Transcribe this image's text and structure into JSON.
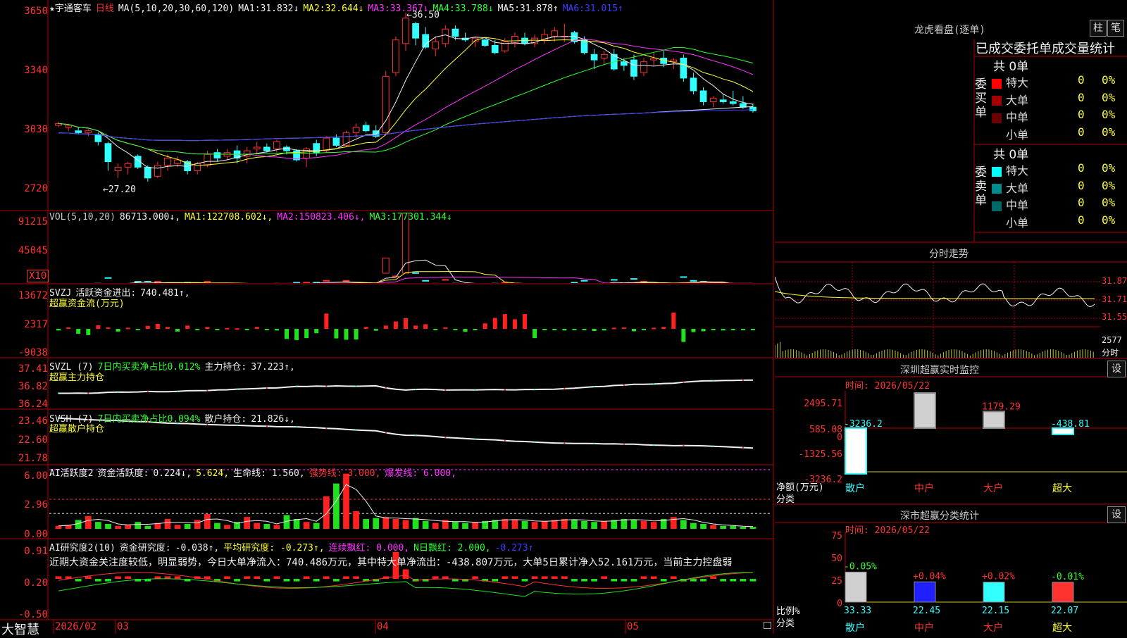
{
  "main": {
    "stock_name": "★宇通客车",
    "period": "日线",
    "ma_header": "MA(5,10,20,30,60,120)",
    "ma": [
      {
        "label": "MA1:",
        "value": "31.832↓",
        "color": "#f0f0f0"
      },
      {
        "label": "MA2:",
        "value": "32.644↓",
        "color": "#ffff32"
      },
      {
        "label": "MA3:",
        "value": "33.367↓",
        "color": "#ff32ff"
      },
      {
        "label": "MA4:",
        "value": "33.788↓",
        "color": "#32ff32"
      },
      {
        "label": "MA5:",
        "value": "31.878↑",
        "color": "#f0f0f0"
      },
      {
        "label": "MA6:",
        "value": "31.015↑",
        "color": "#3c3cff"
      }
    ],
    "y_ticks": [
      "3650",
      "3340",
      "3030",
      "2720"
    ],
    "high_label": "←36.50",
    "low_label": "←27.20"
  },
  "vol": {
    "header": "VOL(5,10,20)",
    "value": "86713.000↓,",
    "ma": [
      {
        "label": "MA1:",
        "value": "122708.602↓,",
        "color": "#ffff32"
      },
      {
        "label": "MA2:",
        "value": "150823.406↓,",
        "color": "#ff32ff"
      },
      {
        "label": "MA3:",
        "value": "177301.344↓",
        "color": "#32ff32"
      }
    ],
    "y_ticks": [
      "91215",
      "45045"
    ],
    "multiplier": "X10"
  },
  "svzj": {
    "header": "SVZJ",
    "label": "活跃资金进出:",
    "value": "740.481↑,",
    "sub": "超赢资金流(万元)",
    "y_ticks": [
      "13672",
      "2317",
      "-9038"
    ]
  },
  "svzl": {
    "header": "SVZL (7)",
    "label": "7日内买卖净占比0.012%",
    "label2": "主力持仓:",
    "value": "37.223↑,",
    "sub": "超赢主力持仓",
    "y_ticks": [
      "37.41",
      "36.82",
      "36.24"
    ]
  },
  "svsh": {
    "header": "SVSH (7)",
    "label": "7日内买卖净占比0.094%",
    "label2": "散户持仓:",
    "value": "21.826↓,",
    "sub": "超赢散户持仓",
    "y_ticks": [
      "23.46",
      "22.60",
      "21.78"
    ]
  },
  "ai1": {
    "header": "AI活跃度2",
    "label": "资金活跃度:",
    "value": "0.224↓,",
    "value2": "5.624,",
    "life": "生命线: 1.560,",
    "strong": "强势线: 3.000,",
    "burst": "爆发线: 6.000,",
    "y_ticks": [
      "6.00",
      "2.96",
      "0.00"
    ]
  },
  "ai2": {
    "header": "AI研究度2(10)",
    "label": "资金研究度:",
    "value": "-0.038↑,",
    "avg": "平均研究度: -0.273↑,",
    "cont": "连续飘红: 0.000,",
    "nday": "N日飘红: 2.000,",
    "last": "-0.273↑",
    "comment": "近期大资金关注度较低，明显弱势，今日大单净流入：740.486万元，其中特大单净流出：-438.807万元，大单5日累计净入52.161万元，当前主力控盘弱",
    "y_ticks": [
      "0.91",
      "0.20",
      "-0.50"
    ]
  },
  "footer": {
    "brand": "大智慧",
    "dates": [
      "2026/02",
      "03",
      "04",
      "05"
    ]
  },
  "longhu": {
    "title": "龙虎看盘(逐单)",
    "btn_zhu": "柱",
    "btn_bi": "笔",
    "subtitle": "已成交委托单成交量统计",
    "buy_label": "委买单",
    "sell_label": "委卖单",
    "buy_total": "共 0单",
    "sell_total": "共 0单",
    "buy_rows": [
      {
        "name": "特大",
        "v": "0",
        "p": "0%",
        "color": "#ff0000"
      },
      {
        "name": "大单",
        "v": "0",
        "p": "0%",
        "color": "#a00000"
      },
      {
        "name": "中单",
        "v": "0",
        "p": "0%",
        "color": "#6a0000"
      },
      {
        "name": "小单",
        "v": "0",
        "p": "0%",
        "color": "#000000"
      }
    ],
    "sell_rows": [
      {
        "name": "特大",
        "v": "0",
        "p": "0%",
        "color": "#00ffff"
      },
      {
        "name": "大单",
        "v": "0",
        "p": "0%",
        "color": "#008c8c"
      },
      {
        "name": "中单",
        "v": "0",
        "p": "0%",
        "color": "#006868"
      },
      {
        "name": "小单",
        "v": "0",
        "p": "0%",
        "color": "#000000"
      }
    ]
  },
  "fenshi": {
    "title": "分时走势",
    "y_ticks": [
      "31.87",
      "31.71",
      "31.55"
    ],
    "vol_tick": "2577",
    "vol_unit": "分时"
  },
  "monitor": {
    "title": "深圳超赢实时监控",
    "set": "设",
    "time": "时间: 2026/05/22",
    "y_ticks": [
      "2495.71",
      "585.08",
      "0",
      "-1325.56",
      "-3236.2"
    ],
    "unit": "净额(万元)",
    "cat_label": "分类",
    "categories": [
      "散户",
      "中户",
      "大户",
      "超大"
    ]
  },
  "classify": {
    "title": "深市超赢分类统计",
    "set": "设",
    "time": "时间: 2026/05/22",
    "y_ticks": [
      "75",
      "50",
      "25",
      "0"
    ],
    "unit": "比例%",
    "cat_label": "分类",
    "categories": [
      "散户",
      "中户",
      "大户",
      "超大"
    ]
  },
  "chart_data": [
    {
      "type": "candlestick",
      "title": "宇通客车 日线",
      "ylim": [
        27.2,
        36.5
      ],
      "ohlc": [
        [
          30.3,
          30.5,
          30.2,
          30.4
        ],
        [
          30.2,
          30.4,
          30.0,
          30.3
        ],
        [
          30.0,
          30.2,
          29.8,
          29.9
        ],
        [
          29.9,
          30.1,
          29.7,
          30.0
        ],
        [
          29.8,
          29.9,
          29.2,
          29.4
        ],
        [
          29.3,
          29.4,
          27.8,
          28.3
        ],
        [
          27.8,
          28.2,
          27.4,
          28.0
        ],
        [
          28.0,
          28.3,
          27.6,
          28.2
        ],
        [
          28.6,
          28.7,
          27.9,
          28.0
        ],
        [
          28.0,
          28.1,
          27.2,
          27.4
        ],
        [
          27.5,
          28.3,
          27.4,
          28.1
        ],
        [
          28.1,
          28.7,
          27.8,
          28.5
        ],
        [
          28.2,
          28.6,
          28.0,
          28.4
        ],
        [
          28.3,
          28.4,
          27.6,
          27.8
        ],
        [
          27.8,
          28.3,
          27.6,
          28.2
        ],
        [
          28.1,
          28.9,
          28.0,
          28.7
        ],
        [
          28.8,
          29.0,
          28.3,
          28.5
        ],
        [
          28.6,
          29.0,
          28.4,
          28.8
        ],
        [
          28.9,
          29.2,
          28.2,
          28.5
        ],
        [
          28.6,
          29.1,
          28.2,
          28.9
        ],
        [
          29.0,
          29.4,
          28.7,
          29.1
        ],
        [
          29.1,
          29.3,
          28.8,
          28.9
        ],
        [
          29.0,
          29.5,
          28.8,
          29.4
        ],
        [
          29.1,
          29.2,
          28.7,
          28.9
        ],
        [
          28.9,
          29.0,
          28.3,
          28.4
        ],
        [
          28.5,
          29.1,
          28.0,
          29.0
        ],
        [
          29.3,
          29.5,
          28.6,
          28.8
        ],
        [
          28.9,
          29.7,
          28.8,
          29.6
        ],
        [
          29.6,
          29.8,
          29.1,
          29.2
        ],
        [
          29.2,
          30.0,
          29.1,
          29.9
        ],
        [
          29.9,
          30.4,
          29.6,
          30.2
        ],
        [
          30.3,
          30.5,
          29.9,
          30.0
        ],
        [
          30.0,
          30.3,
          29.6,
          29.7
        ],
        [
          29.9,
          33.3,
          29.8,
          33.0
        ],
        [
          33.2,
          35.2,
          33.0,
          35.0
        ],
        [
          34.8,
          36.5,
          34.4,
          36.2
        ],
        [
          35.9,
          36.0,
          34.7,
          35.1
        ],
        [
          35.3,
          35.7,
          34.5,
          34.6
        ],
        [
          34.5,
          35.2,
          34.1,
          34.9
        ],
        [
          34.8,
          35.8,
          34.6,
          35.6
        ],
        [
          35.6,
          35.8,
          35.0,
          35.2
        ],
        [
          35.1,
          35.4,
          34.9,
          35.0
        ],
        [
          34.9,
          35.2,
          34.6,
          35.1
        ],
        [
          35.0,
          35.1,
          34.6,
          34.7
        ],
        [
          34.7,
          35.0,
          34.2,
          34.3
        ],
        [
          34.4,
          35.1,
          34.3,
          34.9
        ],
        [
          34.8,
          35.4,
          34.6,
          35.2
        ],
        [
          35.1,
          35.4,
          34.7,
          34.8
        ],
        [
          34.8,
          35.3,
          34.6,
          35.1
        ],
        [
          35.0,
          35.6,
          34.8,
          35.3
        ],
        [
          35.2,
          35.7,
          34.9,
          35.5
        ],
        [
          35.2,
          35.9,
          34.9,
          35.2
        ],
        [
          35.4,
          35.5,
          34.8,
          34.9
        ],
        [
          35.0,
          35.2,
          34.2,
          34.3
        ],
        [
          34.2,
          34.5,
          33.4,
          33.9
        ],
        [
          34.0,
          34.4,
          33.6,
          34.2
        ],
        [
          34.2,
          34.5,
          33.3,
          33.4
        ],
        [
          33.8,
          34.0,
          33.3,
          33.6
        ],
        [
          33.9,
          34.2,
          32.8,
          33.0
        ],
        [
          33.2,
          34.0,
          33.0,
          33.8
        ],
        [
          33.9,
          34.3,
          33.6,
          34.0
        ],
        [
          34.0,
          34.4,
          33.5,
          33.7
        ],
        [
          33.8,
          34.0,
          33.4,
          33.9
        ],
        [
          34.0,
          34.2,
          32.7,
          32.9
        ],
        [
          32.9,
          33.2,
          32.0,
          32.2
        ],
        [
          32.2,
          32.4,
          31.4,
          31.6
        ],
        [
          31.6,
          31.9,
          31.3,
          31.8
        ],
        [
          31.7,
          32.0,
          31.5,
          31.6
        ],
        [
          31.6,
          32.2,
          31.4,
          31.5
        ],
        [
          31.5,
          31.9,
          31.2,
          31.3
        ],
        [
          31.3,
          31.5,
          31.0,
          31.1
        ]
      ]
    },
    {
      "type": "bar",
      "title": "SVZJ 超赢资金流(万元)",
      "ylim": [
        -9038,
        13672
      ],
      "values": [
        -600,
        500,
        -1800,
        -2300,
        1300,
        500,
        -1000,
        400,
        -400,
        1100,
        1800,
        700,
        -1000,
        1200,
        -500,
        700,
        -300,
        300,
        200,
        -500,
        700,
        -300,
        -600,
        -3700,
        -4100,
        -3400,
        -1600,
        5600,
        -3500,
        -4000,
        -3900,
        700,
        -700,
        1200,
        2700,
        3900,
        1200,
        1700,
        -500,
        500,
        -400,
        -1100,
        -200,
        2000,
        4000,
        5400,
        3500,
        5400,
        -3400,
        -500,
        -400,
        -600,
        -500,
        -500,
        -800,
        -600,
        400,
        500,
        -900,
        -500,
        400,
        700,
        6000,
        -4800,
        -1200,
        -900,
        -300,
        -600,
        -300,
        -100,
        -200
      ]
    },
    {
      "type": "bar",
      "title": "AI活跃度2 资金活跃度",
      "ylim": [
        0,
        6.0
      ],
      "values": [
        0.3,
        0.4,
        0.9,
        1.3,
        0.7,
        0.5,
        0.3,
        0.4,
        0.7,
        0.3,
        0.6,
        1.0,
        0.4,
        0.5,
        0.9,
        1.5,
        0.6,
        0.4,
        0.7,
        1.2,
        0.6,
        0.5,
        0.4,
        1.4,
        1.0,
        0.7,
        0.6,
        3.3,
        4.6,
        5.6,
        1.8,
        1.0,
        1.1,
        1.2,
        1.0,
        0.9,
        1.1,
        0.8,
        0.6,
        0.9,
        0.7,
        0.6,
        0.7,
        0.8,
        0.9,
        1.0,
        0.9,
        0.8,
        0.7,
        0.8,
        0.9,
        1.0,
        0.9,
        0.8,
        0.7,
        0.8,
        0.9,
        1.0,
        0.9,
        0.8,
        0.7,
        1.0,
        1.2,
        0.9,
        0.6,
        0.5,
        0.4,
        0.3,
        0.3,
        0.2,
        0.2
      ]
    },
    {
      "type": "bar",
      "title": "深圳超赢实时监控 净额(万元)",
      "categories": [
        "散户",
        "中户",
        "大户",
        "超大"
      ],
      "values": [
        -3236.2,
        2495.71,
        1179.29,
        -438.81
      ]
    },
    {
      "type": "bar",
      "title": "深市超赢分类统计 比例%",
      "categories": [
        "散户",
        "中户",
        "大户",
        "超大"
      ],
      "values": [
        33.33,
        22.45,
        22.15,
        22.07
      ],
      "changes": [
        "-0.05%",
        "+0.04%",
        "+0.02%",
        "-0.01%"
      ]
    }
  ]
}
